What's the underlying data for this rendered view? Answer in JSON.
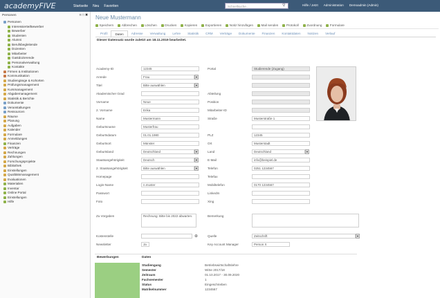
{
  "topbar": {
    "logo": "academyFIVE",
    "nav": [
      "Startseite",
      "Neu",
      "Favoriten"
    ],
    "search_placeholder": "Schnellsuche...",
    "right_items": [
      "Hilfe / Jetzt",
      "Administration",
      "Demoadmin (Admin)"
    ]
  },
  "sidebar": {
    "header": "Personen",
    "actions": "≡ □ ✖",
    "items": [
      {
        "label": "Personen",
        "color": "#7aa0c8"
      },
      {
        "label": "Interessierte/Bewerber",
        "color": "#8fb24a"
      },
      {
        "label": "Bewerber",
        "color": "#8fb24a"
      },
      {
        "label": "Studenten",
        "color": "#8fb24a"
      },
      {
        "label": "Alumni",
        "color": "#8fb24a"
      },
      {
        "label": "Berufsbegleitende",
        "color": "#8fb24a"
      },
      {
        "label": "Dozenten",
        "color": "#8fb24a"
      },
      {
        "label": "Mitarbeiter",
        "color": "#8fb24a"
      },
      {
        "label": "Gastdozierende",
        "color": "#8fb24a"
      },
      {
        "label": "Personalverwaltung",
        "color": "#8fb24a"
      },
      {
        "label": "Kontakte",
        "color": "#8fb24a"
      },
      {
        "label": "Firmen & Institutionen",
        "color": "#c87a4a"
      },
      {
        "label": "Kommunikation",
        "color": "#c87a4a"
      },
      {
        "label": "Studiengänge & Kohorten",
        "color": "#d4a84a"
      },
      {
        "label": "Prüfungsmanagement",
        "color": "#d4a84a"
      },
      {
        "label": "Kursmanagement",
        "color": "#d4a84a"
      },
      {
        "label": "Abgabemanagement",
        "color": "#d4a84a"
      },
      {
        "label": "Statistik & Berichte",
        "color": "#d4a84a"
      },
      {
        "label": "Dokumente",
        "color": "#7aa0c8"
      },
      {
        "label": "Veranstaltungen",
        "color": "#7aa0c8"
      },
      {
        "label": "Ressourcen",
        "color": "#7aa0c8"
      },
      {
        "label": "Räume",
        "color": "#d4a84a"
      },
      {
        "label": "Planung",
        "color": "#d4a84a"
      },
      {
        "label": "Aufgaben",
        "color": "#d4a84a"
      },
      {
        "label": "Kalender",
        "color": "#d4a84a"
      },
      {
        "label": "Formulare",
        "color": "#d4a84a"
      },
      {
        "label": "Anmeldungen",
        "color": "#d4a84a"
      },
      {
        "label": "Finanzen",
        "color": "#8fb24a"
      },
      {
        "label": "Verträge",
        "color": "#d4a84a"
      },
      {
        "label": "Rechnungen",
        "color": "#d4a84a"
      },
      {
        "label": "Zahlungen",
        "color": "#d4a84a"
      },
      {
        "label": "Forschungsprojekte",
        "color": "#d4a84a"
      },
      {
        "label": "Bibliothek",
        "color": "#d4a84a"
      },
      {
        "label": "Einstellungen",
        "color": "#d4a84a"
      },
      {
        "label": "Qualitätsmanagement",
        "color": "#d4a84a"
      },
      {
        "label": "Evaluationen",
        "color": "#d4a84a"
      },
      {
        "label": "Materialien",
        "color": "#8fb24a"
      },
      {
        "label": "Inventar",
        "color": "#8fb24a"
      },
      {
        "label": "Online Portal",
        "color": "#8fb24a"
      },
      {
        "label": "Einstellungen",
        "color": "#8fb24a"
      },
      {
        "label": "Hilfe",
        "color": "#8fb24a"
      }
    ]
  },
  "main": {
    "page_title": "Neue Mustermann",
    "toolbar": [
      "Speichern",
      "Abbrechen",
      "Löschen",
      "Drucken",
      "Kopieren",
      "Exportieren",
      "Notiz hinzufügen",
      "Mail senden",
      "Protokoll",
      "Zuordnung",
      "Formulare"
    ],
    "tabs": [
      "Profil",
      "Daten",
      "Adresse",
      "Verwaltung",
      "Lehre",
      "Statistik",
      "CRM",
      "Verträge",
      "Dokumente",
      "Finanzen",
      "Kontaktdaten",
      "Notizen",
      "Verlauf"
    ],
    "active_tab": 1,
    "subtitle": "Dieser Datensatz wurde zuletzt am 18.11.2019 bearbeitet."
  },
  "form_left": [
    {
      "label": "Academy-ID",
      "value": "12345",
      "dd": false
    },
    {
      "label": "Anrede",
      "value": "Frau",
      "dd": true
    },
    {
      "label": "Titel",
      "value": "Bitte auswählen",
      "dd": true
    },
    {
      "label": "Akademischer Grad",
      "value": "",
      "dd": false
    },
    {
      "label": "Vorname",
      "value": "Neue",
      "dd": false
    },
    {
      "label": "2. Vorname",
      "value": "Erika",
      "dd": false
    },
    {
      "label": "Name",
      "value": "Mustermann",
      "dd": false
    },
    {
      "label": "Geburtsname",
      "value": "Musterfrau",
      "dd": false
    },
    {
      "label": "Geburtsdatum",
      "value": "01.01.1980",
      "dd": false
    },
    {
      "label": "Geburtsort",
      "value": "Münster",
      "dd": false
    },
    {
      "label": "Geburtsland",
      "value": "Deutschland",
      "dd": true
    },
    {
      "label": "Staatsangehörigkeit",
      "value": "Deutsch",
      "dd": true
    },
    {
      "label": "2. Staatsangehörigkeit",
      "value": "Bitte auswählen",
      "dd": true
    },
    {
      "label": "Homepage",
      "value": "",
      "dd": false
    },
    {
      "label": "Login-Name",
      "value": "n.muster",
      "dd": false
    },
    {
      "label": "Passwort",
      "value": "",
      "dd": false
    },
    {
      "label": "Foto",
      "value": "",
      "dd": false
    }
  ],
  "form_right": [
    {
      "label": "Portal",
      "value": "Studierende (Zugang)",
      "ro": true,
      "dd": false
    },
    {
      "label": "",
      "value": "",
      "ro": true,
      "dd": false
    },
    {
      "label": "",
      "value": "",
      "ro": true,
      "dd": false
    },
    {
      "label": "Abteilung",
      "value": "",
      "ro": true,
      "dd": false
    },
    {
      "label": "Position",
      "value": "",
      "ro": true,
      "dd": false
    },
    {
      "label": "Mitarbeiter-ID",
      "value": "",
      "ro": true,
      "dd": false
    },
    {
      "label": "Straße",
      "value": "Musterstraße 1",
      "ro": false,
      "dd": false
    },
    {
      "label": "",
      "value": "",
      "ro": false,
      "dd": false
    },
    {
      "label": "PLZ",
      "value": "12345",
      "ro": false,
      "dd": false
    },
    {
      "label": "Ort",
      "value": "Musterstadt",
      "ro": false,
      "dd": false
    },
    {
      "label": "Land",
      "value": "Deutschland",
      "ro": false,
      "dd": true
    },
    {
      "label": "E-Mail",
      "value": "info@beispiel.de",
      "ro": false,
      "dd": false
    },
    {
      "label": "Telefon",
      "value": "0251 1234567",
      "ro": false,
      "dd": false
    },
    {
      "label": "Telefax",
      "value": "",
      "ro": false,
      "dd": false
    },
    {
      "label": "Mobiltelefon",
      "value": "0170 1234567",
      "ro": false,
      "dd": false
    },
    {
      "label": "LinkedIn",
      "value": "",
      "ro": false,
      "dd": false
    },
    {
      "label": "Xing",
      "value": "",
      "ro": false,
      "dd": false
    }
  ],
  "extra": {
    "notes_label": "Zu Vorgaben",
    "notes_value": "Rechnung: Bitte bis 2022 abwarten.",
    "bemerkung_label": "Bemerkung",
    "cost_label": "Kostenstelle",
    "quelle_label": "Quelle",
    "quelle_value": "Zeitschrift",
    "newsletter_label": "Newsletter",
    "newsletter_value": "Ja",
    "manager_label": "Key Account Manager",
    "manager_value": "Person X"
  },
  "bottom": {
    "section1": "Bewerbungen",
    "section2": "Daten",
    "details": [
      {
        "k": "Studiengang",
        "v": "Betriebswirtschaftslehre"
      },
      {
        "k": "Semester",
        "v": "WiSe 2017/18"
      },
      {
        "k": "Zeitraum",
        "v": "01.10.2017 - 30.09.2020"
      },
      {
        "k": "Fachsemester",
        "v": "1"
      },
      {
        "k": "Status",
        "v": "Eingeschrieben"
      },
      {
        "k": "Matrikelnummer",
        "v": "1234567"
      }
    ]
  }
}
